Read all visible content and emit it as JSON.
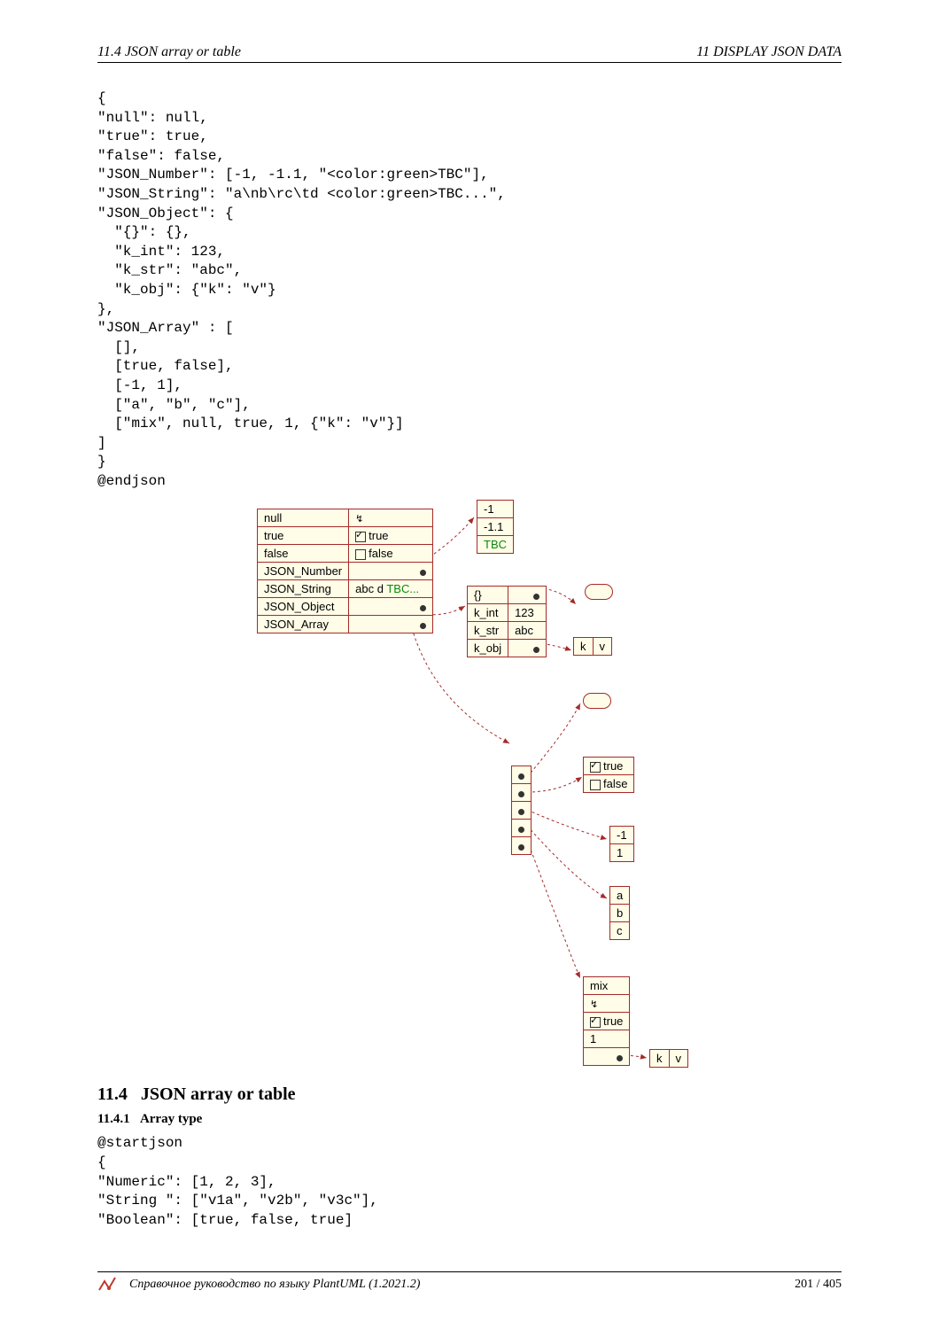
{
  "header": {
    "left": "11.4   JSON array or table",
    "right": "11   DISPLAY JSON DATA"
  },
  "code1": "{\n\"null\": null,\n\"true\": true,\n\"false\": false,\n\"JSON_Number\": [-1, -1.1, \"<color:green>TBC\"],\n\"JSON_String\": \"a\\nb\\rc\\td <color:green>TBC...\",\n\"JSON_Object\": {\n  \"{}\": {},\n  \"k_int\": 123,\n  \"k_str\": \"abc\",\n  \"k_obj\": {\"k\": \"v\"}\n},\n\"JSON_Array\" : [\n  [],\n  [true, false],\n  [-1, 1],\n  [\"a\", \"b\", \"c\"],\n  [\"mix\", null, true, 1, {\"k\": \"v\"}]\n]\n}\n@endjson",
  "diagram": {
    "main_rows": [
      {
        "k": "null",
        "v_type": "null_sym"
      },
      {
        "k": "true",
        "v_type": "check_true",
        "v": "true"
      },
      {
        "k": "false",
        "v_type": "check_false",
        "v": "false"
      },
      {
        "k": "JSON_Number",
        "v_type": "dot"
      },
      {
        "k": "JSON_String",
        "v_type": "text_tbc",
        "v": "abc  d ",
        "tbc": "TBC..."
      },
      {
        "k": "JSON_Object",
        "v_type": "dot"
      },
      {
        "k": "JSON_Array",
        "v_type": "dot"
      }
    ],
    "num_arr": [
      "-1",
      "-1.1",
      "TBC"
    ],
    "obj_rows": [
      {
        "k": "{}",
        "v_type": "dot"
      },
      {
        "k": "k_int",
        "v": "123"
      },
      {
        "k": "k_str",
        "v": "abc"
      },
      {
        "k": "k_obj",
        "v_type": "dot"
      }
    ],
    "kv": {
      "k": "k",
      "v": "v"
    },
    "tf_box": {
      "t": "true",
      "f": "false"
    },
    "neg_one_one": [
      "-1",
      "1"
    ],
    "abc": [
      "a",
      "b",
      "c"
    ],
    "mix_rows": [
      "mix",
      "null_sym",
      "check_true",
      "1",
      "dot"
    ],
    "mix_true_label": "true"
  },
  "section": {
    "num": "11.4",
    "title": "JSON array or table",
    "sub_num": "11.4.1",
    "sub_title": "Array type"
  },
  "code2": "@startjson\n{\n\"Numeric\": [1, 2, 3],\n\"String \": [\"v1a\", \"v2b\", \"v3c\"],\n\"Boolean\": [true, false, true]",
  "footer": {
    "text": "Справочное руководство по языку PlantUML (1.2021.2)",
    "page": "201 / 405"
  }
}
